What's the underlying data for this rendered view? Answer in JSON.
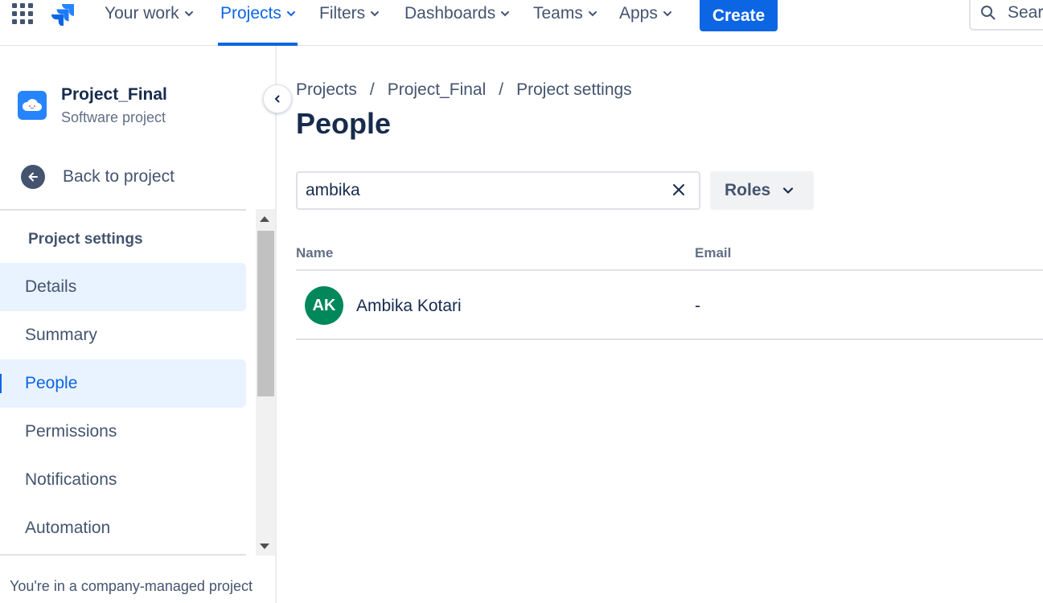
{
  "nav": {
    "items": [
      {
        "label": "Your work"
      },
      {
        "label": "Projects"
      },
      {
        "label": "Filters"
      },
      {
        "label": "Dashboards"
      },
      {
        "label": "Teams"
      },
      {
        "label": "Apps"
      }
    ],
    "active_index": 1,
    "create_label": "Create",
    "search_placeholder": "Sear",
    "accent": "#0c66e4"
  },
  "sidebar": {
    "project_name": "Project_Final",
    "project_type": "Software project",
    "back_label": "Back to project",
    "section_title": "Project settings",
    "items": [
      {
        "label": "Details"
      },
      {
        "label": "Summary"
      },
      {
        "label": "People"
      },
      {
        "label": "Permissions"
      },
      {
        "label": "Notifications"
      },
      {
        "label": "Automation"
      }
    ],
    "selected_item": "People",
    "footer_note": "You're in a company-managed project"
  },
  "main": {
    "breadcrumb": [
      "Projects",
      "Project_Final",
      "Project settings"
    ],
    "breadcrumb_separator": "/",
    "title": "People",
    "filter_value": "ambika",
    "roles_label": "Roles",
    "table": {
      "columns": [
        "Name",
        "Email"
      ],
      "rows": [
        {
          "initials": "AK",
          "name": "Ambika Kotari",
          "email": "-",
          "avatar_color": "#00875a"
        }
      ]
    }
  }
}
